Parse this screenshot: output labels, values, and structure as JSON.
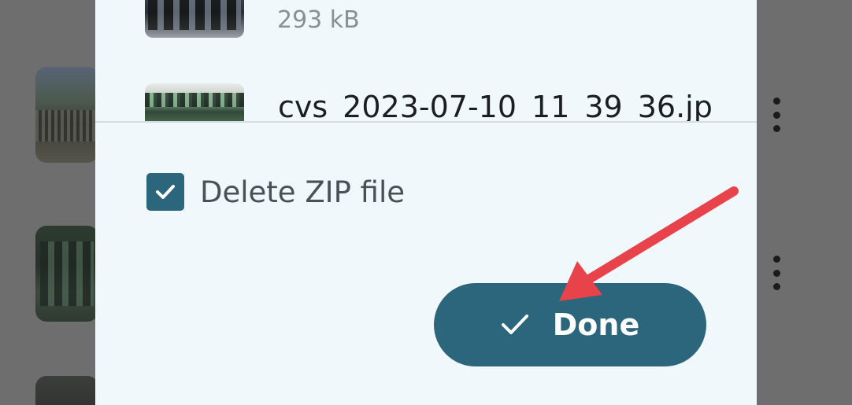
{
  "dialog": {
    "files": [
      {
        "size": "293 kB"
      },
      {
        "name": "cvs_2023-07-10_11_39_36.jp"
      }
    ],
    "delete_zip": {
      "label": "Delete ZIP file",
      "checked": true
    },
    "done_button": {
      "label": "Done",
      "icon": "check-icon"
    }
  },
  "colors": {
    "accent": "#2b667c",
    "dialog_background": "#f1f8fb",
    "scrim": "#6e6e6e",
    "annotation_arrow": "#e8434a"
  }
}
